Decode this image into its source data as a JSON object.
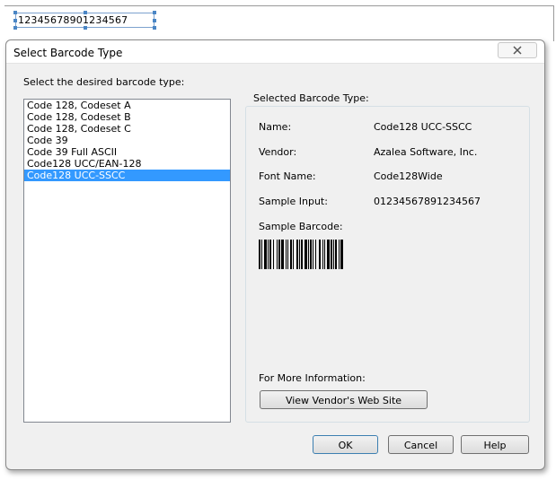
{
  "background_document": {
    "field_value": "12345678901234567"
  },
  "dialog": {
    "title": "Select Barcode Type",
    "left_label": "Select the desired barcode type:",
    "barcode_types": [
      "Code 128, Codeset A",
      "Code 128, Codeset B",
      "Code 128, Codeset C",
      "Code 39",
      "Code 39 Full ASCII",
      "Code128 UCC/EAN-128",
      "Code128 UCC-SSCC"
    ],
    "selected_index": 6,
    "group_title": "Selected Barcode Type:",
    "details": {
      "name_label": "Name:",
      "name_value": "Code128 UCC-SSCC",
      "vendor_label": "Vendor:",
      "vendor_value": "Azalea Software, Inc.",
      "font_label": "Font Name:",
      "font_value": "Code128Wide",
      "sample_input_label": "Sample Input:",
      "sample_input_value": "01234567891234567",
      "sample_barcode_label": "Sample Barcode:"
    },
    "more_info_label": "For More Information:",
    "vendor_site_button": "View Vendor's Web Site",
    "ok_button": "OK",
    "cancel_button": "Cancel",
    "help_button": "Help"
  },
  "colors": {
    "selection": "#3399ff",
    "dialog_bg": "#f0f0f0",
    "field_border": "#7da2ce"
  }
}
